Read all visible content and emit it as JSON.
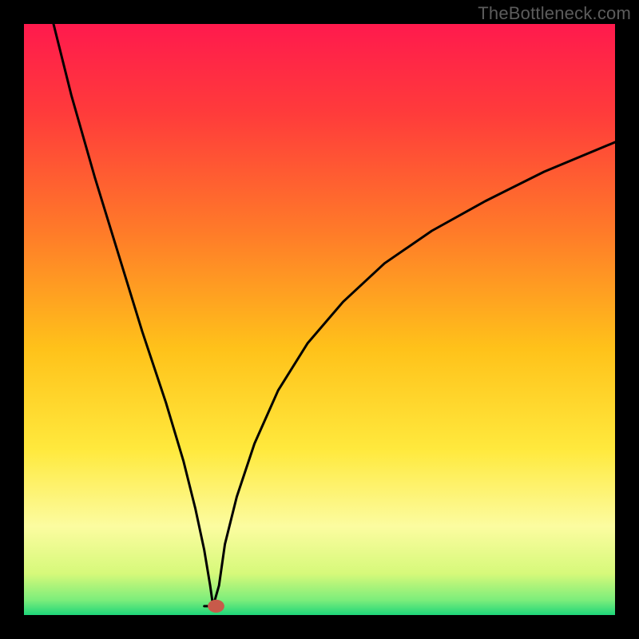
{
  "watermark": "TheBottleneck.com",
  "colors": {
    "frame": "#000000",
    "gradient_stops": [
      {
        "offset": 0.0,
        "color": "#ff1a4d"
      },
      {
        "offset": 0.15,
        "color": "#ff3b3b"
      },
      {
        "offset": 0.35,
        "color": "#ff7a29"
      },
      {
        "offset": 0.55,
        "color": "#ffc21a"
      },
      {
        "offset": 0.72,
        "color": "#ffe93d"
      },
      {
        "offset": 0.85,
        "color": "#fcfca0"
      },
      {
        "offset": 0.93,
        "color": "#d6f97a"
      },
      {
        "offset": 0.975,
        "color": "#7bed7b"
      },
      {
        "offset": 1.0,
        "color": "#1fd67a"
      }
    ],
    "curve": "#000000",
    "marker": "#c85a4a"
  },
  "chart_data": {
    "type": "line",
    "title": "",
    "xlabel": "",
    "ylabel": "",
    "xlim": [
      0,
      100
    ],
    "ylim": [
      0,
      100
    ],
    "marker": {
      "x": 32.5,
      "y": 1.5,
      "rx": 1.4,
      "ry": 1.1
    },
    "series": [
      {
        "name": "curve",
        "x": [
          5,
          8,
          12,
          16,
          20,
          24,
          27,
          29,
          30.5,
          31.5,
          32,
          33,
          34,
          36,
          39,
          43,
          48,
          54,
          61,
          69,
          78,
          88,
          100
        ],
        "values": [
          100,
          88,
          74,
          61,
          48,
          36,
          26,
          18,
          11,
          5,
          1.5,
          5,
          12,
          20,
          29,
          38,
          46,
          53,
          59.5,
          65,
          70,
          75,
          80
        ]
      },
      {
        "name": "floor-segment",
        "x": [
          30.5,
          33.5
        ],
        "values": [
          1.5,
          1.5
        ]
      }
    ]
  }
}
